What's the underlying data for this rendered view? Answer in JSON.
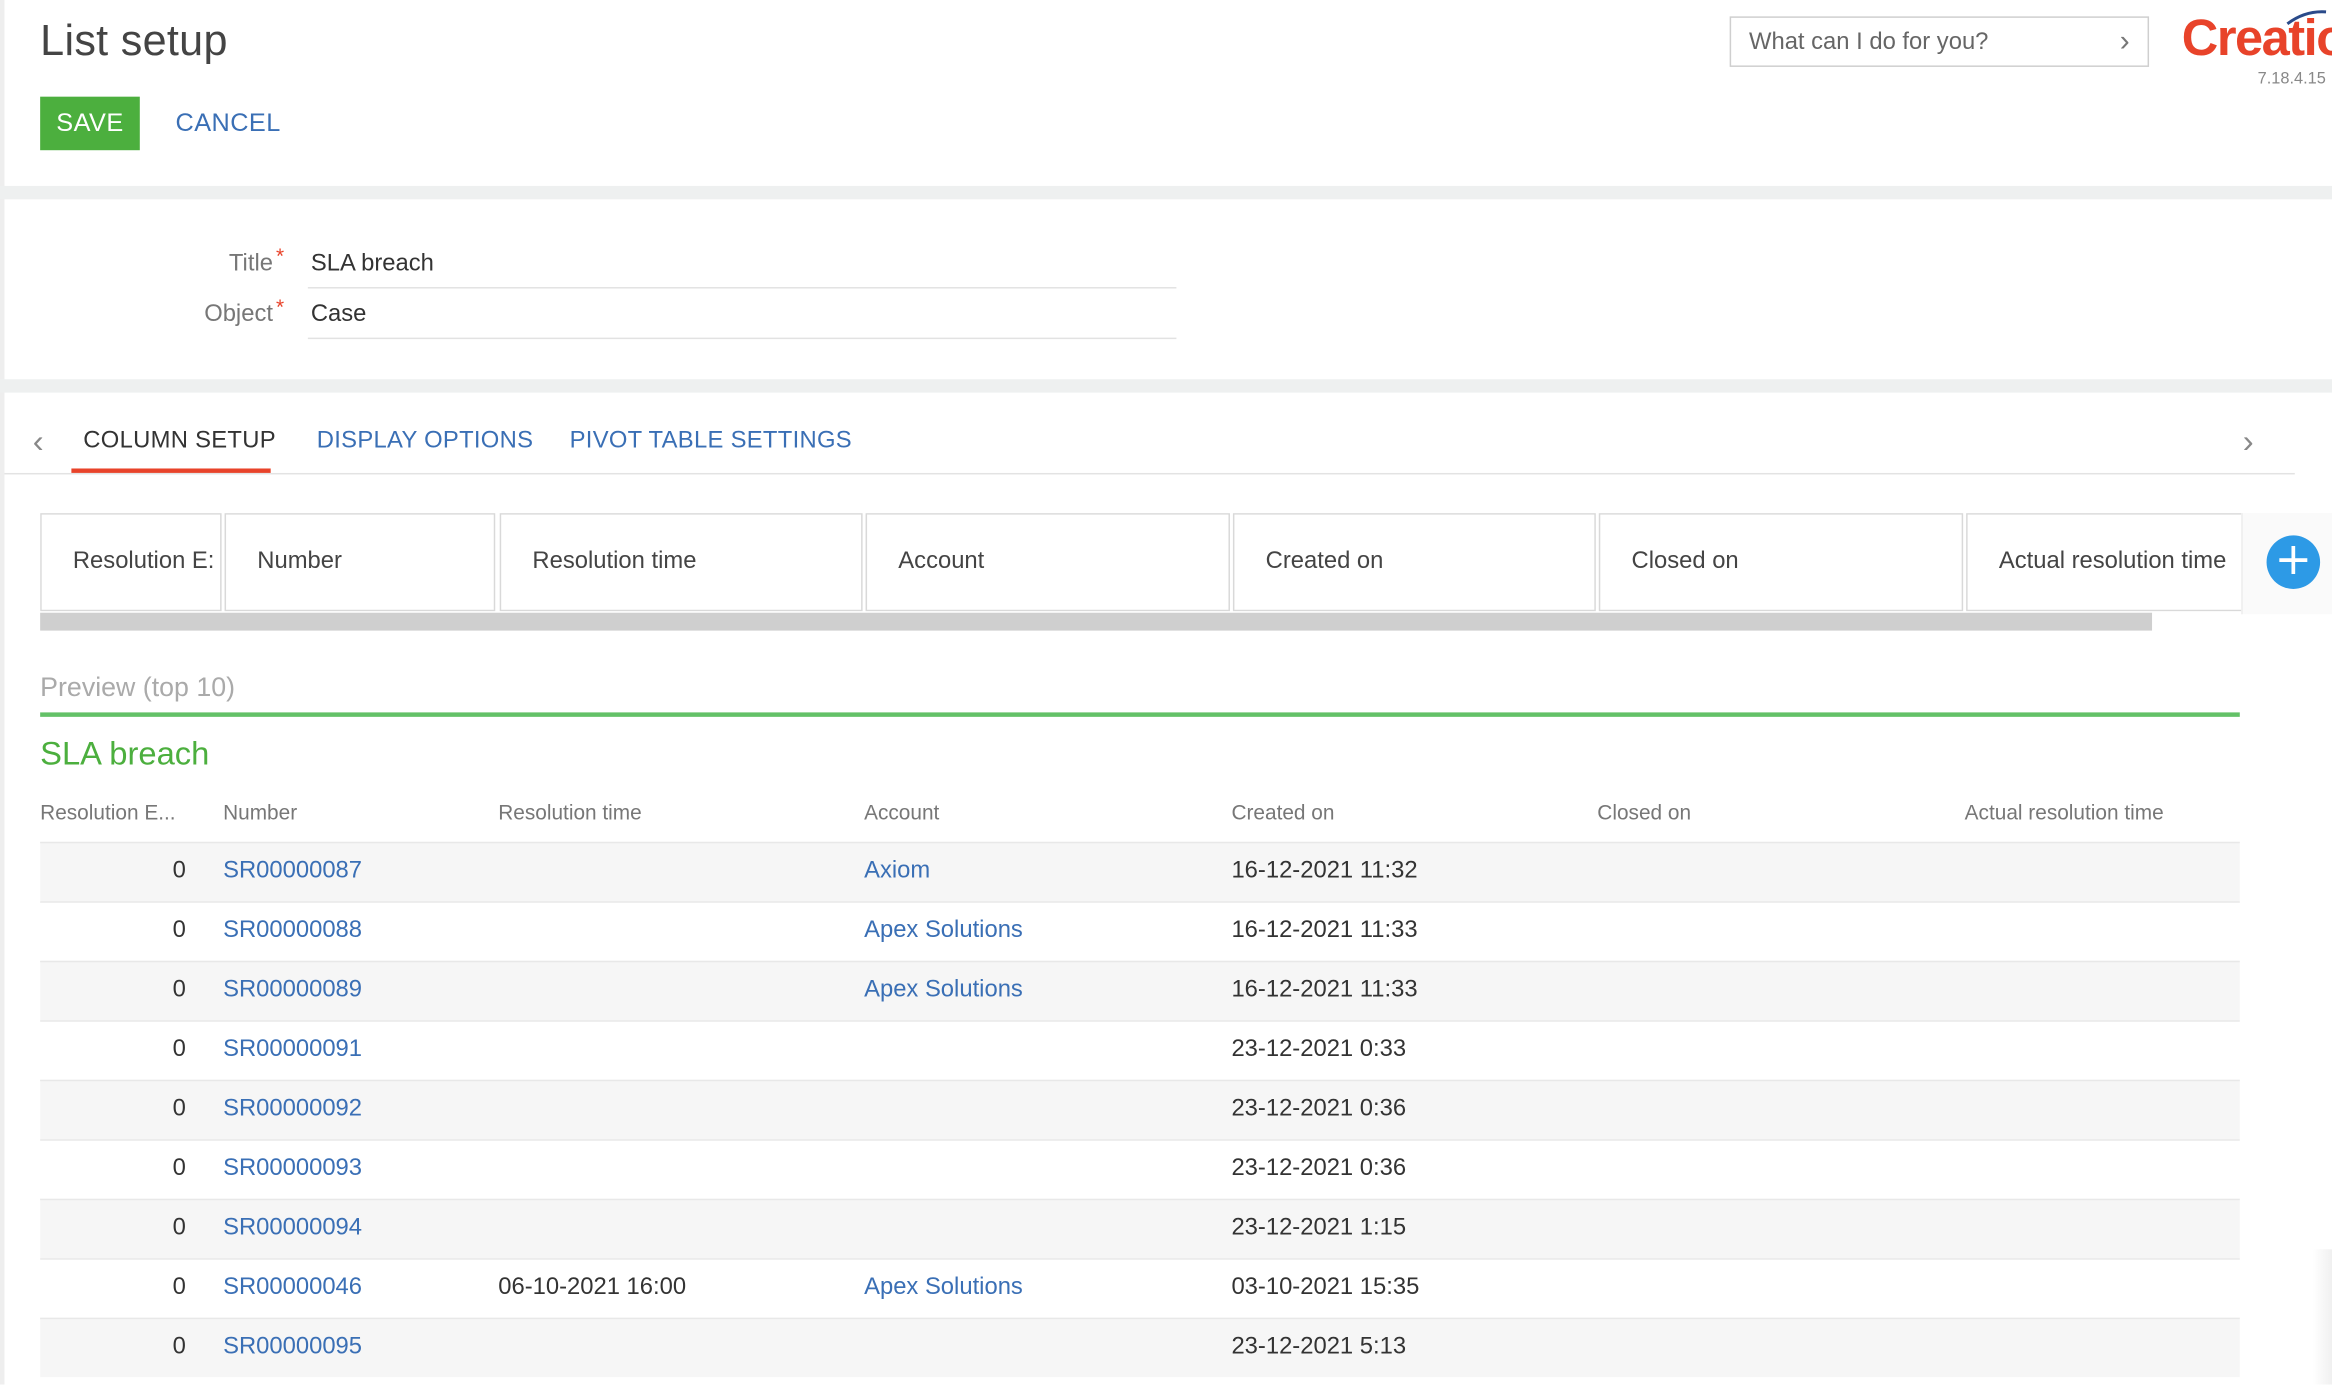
{
  "header": {
    "title": "List setup",
    "save_label": "SAVE",
    "cancel_label": "CANCEL",
    "command_placeholder": "What can I do for you?",
    "logo_text": "Creatio",
    "version": "7.18.4.15"
  },
  "form": {
    "title_label": "Title",
    "title_value": "SLA breach",
    "object_label": "Object",
    "object_value": "Case",
    "required_mark": "*"
  },
  "tabs": [
    {
      "label": "COLUMN SETUP",
      "active": true
    },
    {
      "label": "DISPLAY OPTIONS",
      "active": false
    },
    {
      "label": "PIVOT TABLE SETTINGS",
      "active": false
    }
  ],
  "column_setup": {
    "columns": [
      "Resolution E:",
      "Number",
      "Resolution time",
      "Account",
      "Created on",
      "Closed on",
      "Actual resolution time"
    ],
    "add_glyph": "+"
  },
  "preview": {
    "caption": "Preview (top 10)",
    "grid_title": "SLA breach",
    "headers": [
      "Resolution E...",
      "Number",
      "Resolution time",
      "Account",
      "Created on",
      "Closed on",
      "Actual resolution time"
    ],
    "rows": [
      {
        "resolution_e": "0",
        "number": "SR00000087",
        "resolution_time": "",
        "account": "Axiom",
        "created_on": "16-12-2021 11:32",
        "closed_on": "",
        "actual": ""
      },
      {
        "resolution_e": "0",
        "number": "SR00000088",
        "resolution_time": "",
        "account": "Apex Solutions",
        "created_on": "16-12-2021 11:33",
        "closed_on": "",
        "actual": ""
      },
      {
        "resolution_e": "0",
        "number": "SR00000089",
        "resolution_time": "",
        "account": "Apex Solutions",
        "created_on": "16-12-2021 11:33",
        "closed_on": "",
        "actual": ""
      },
      {
        "resolution_e": "0",
        "number": "SR00000091",
        "resolution_time": "",
        "account": "",
        "created_on": "23-12-2021 0:33",
        "closed_on": "",
        "actual": ""
      },
      {
        "resolution_e": "0",
        "number": "SR00000092",
        "resolution_time": "",
        "account": "",
        "created_on": "23-12-2021 0:36",
        "closed_on": "",
        "actual": ""
      },
      {
        "resolution_e": "0",
        "number": "SR00000093",
        "resolution_time": "",
        "account": "",
        "created_on": "23-12-2021 0:36",
        "closed_on": "",
        "actual": ""
      },
      {
        "resolution_e": "0",
        "number": "SR00000094",
        "resolution_time": "",
        "account": "",
        "created_on": "23-12-2021 1:15",
        "closed_on": "",
        "actual": ""
      },
      {
        "resolution_e": "0",
        "number": "SR00000046",
        "resolution_time": "06-10-2021 16:00",
        "account": "Apex Solutions",
        "created_on": "03-10-2021 15:35",
        "closed_on": "",
        "actual": ""
      },
      {
        "resolution_e": "0",
        "number": "SR00000095",
        "resolution_time": "",
        "account": "",
        "created_on": "23-12-2021 5:13",
        "closed_on": "",
        "actual": ""
      }
    ]
  },
  "colors": {
    "save_green": "#4caf3e",
    "link_blue": "#3a6fb5",
    "accent_red": "#e8432a",
    "add_blue": "#2d9ae6"
  }
}
